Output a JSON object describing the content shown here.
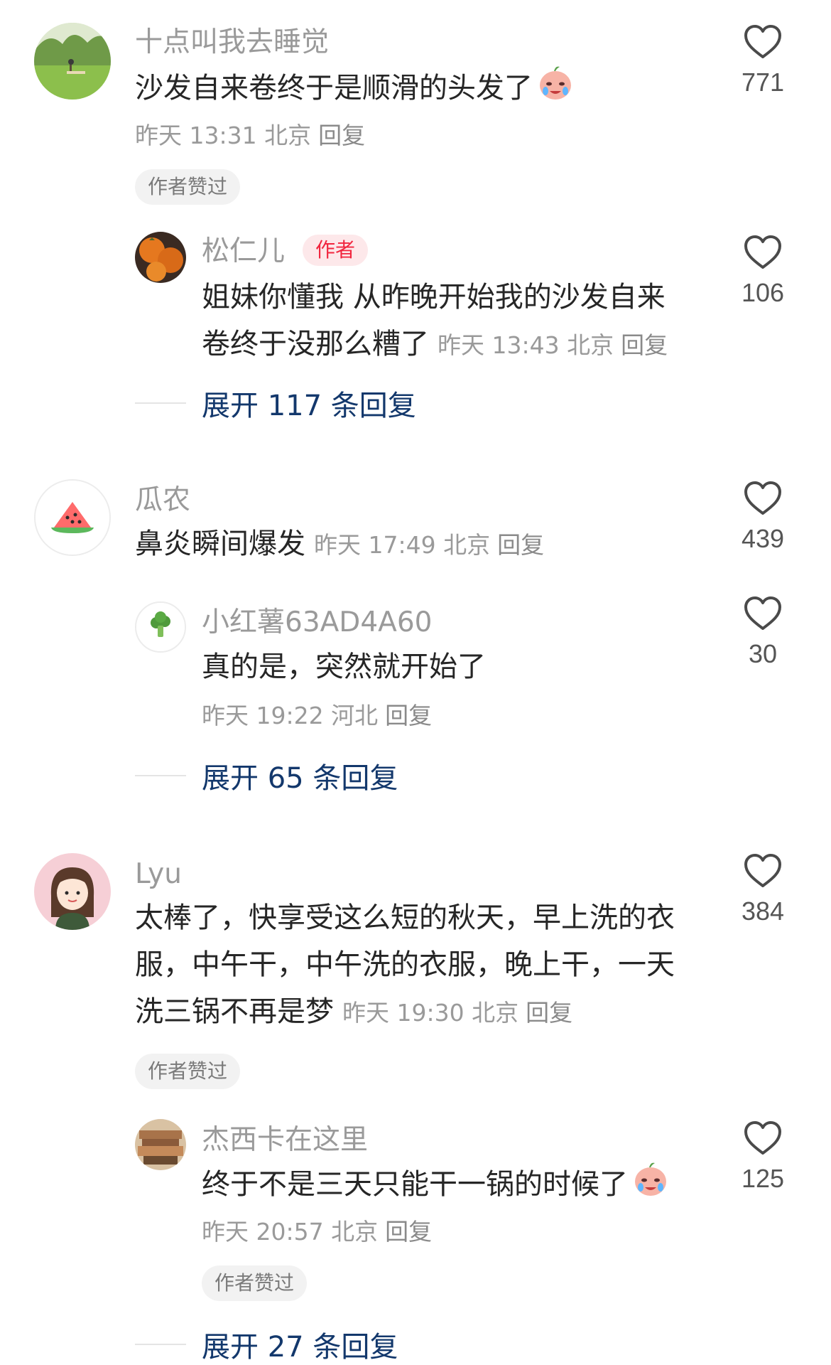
{
  "comments": [
    {
      "username": "十点叫我去睡觉",
      "text": "沙发自来卷终于是顺滑的头发了",
      "meta": "昨天 13:31 北京",
      "reply": "回复",
      "badge": "作者赞过",
      "likes": "771",
      "avatar": "meadow-photo-avatar",
      "reply_item": {
        "username": "松仁儿",
        "author_tag": "作者",
        "text_line1": "姐妹你懂我 从昨晚开始我的沙发自来",
        "text_line2": "卷终于没那么糟了",
        "meta": "昨天 13:43 北京",
        "reply": "回复",
        "likes": "106",
        "avatar": "persimmon-photo-avatar"
      },
      "expand": "展开 117 条回复"
    },
    {
      "username": "瓜农",
      "text": "鼻炎瞬间爆发",
      "meta": "昨天 17:49 北京",
      "reply": "回复",
      "likes": "439",
      "avatar": "watermelon-avatar",
      "reply_item": {
        "username": "小红薯63AD4A60",
        "text_line1": "真的是，突然就开始了",
        "meta": "昨天 19:22 河北",
        "reply": "回复",
        "likes": "30",
        "avatar": "broccoli-avatar"
      },
      "expand": "展开 65 条回复"
    },
    {
      "username": "Lyu",
      "text_line1": "太棒了，快享受这么短的秋天，早上洗的衣",
      "text_line2": "服，中午干，中午洗的衣服，晚上干，一天",
      "text_line3": "洗三锅不再是梦",
      "meta": "昨天 19:30 北京",
      "reply": "回复",
      "badge": "作者赞过",
      "likes": "384",
      "avatar": "cartoon-girl-avatar",
      "reply_item": {
        "username": "杰西卡在这里",
        "text_line1": "终于不是三天只能干一锅的时候了",
        "meta": "昨天 20:57 北京",
        "reply": "回复",
        "badge": "作者赞过",
        "likes": "125",
        "avatar": "books-photo-avatar"
      },
      "expand": "展开 27 条回复"
    }
  ],
  "icons": {
    "like": "heart-outline-icon",
    "emoji": "crying-face-emoji"
  },
  "colors": {
    "author_tag": "#f1263f",
    "expand_link": "#13386c",
    "secondary_text": "#9a9a9a"
  }
}
